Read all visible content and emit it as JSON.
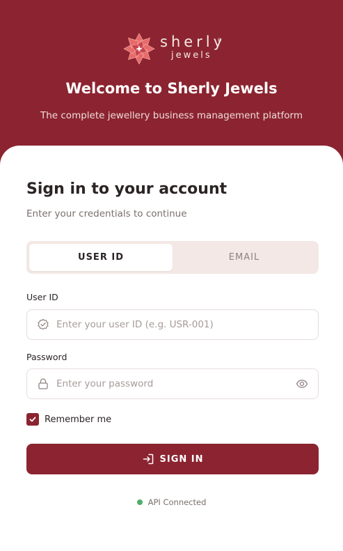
{
  "brand": {
    "line1": "sherly",
    "line2": "jewels",
    "reg_mark": "®",
    "logo_icon": "flower-gem-icon"
  },
  "hero": {
    "title": "Welcome to Sherly Jewels",
    "subtitle": "The complete jewellery business management platform"
  },
  "form": {
    "title": "Sign in to your account",
    "subtitle": "Enter your credentials to continue",
    "tabs": [
      {
        "label": "USER ID",
        "active": true
      },
      {
        "label": "EMAIL",
        "active": false
      }
    ],
    "user_id": {
      "label": "User ID",
      "placeholder": "Enter your user ID (e.g. USR-001)",
      "value": "",
      "icon": "badge-check-icon"
    },
    "password": {
      "label": "Password",
      "placeholder": "Enter your password",
      "value": "",
      "icon": "lock-icon",
      "toggle_icon": "eye-icon"
    },
    "remember": {
      "label": "Remember me",
      "checked": true
    },
    "submit_label": "SIGN IN",
    "submit_icon": "sign-in-icon"
  },
  "status": {
    "text": "API Connected",
    "color": "#4caf6a"
  },
  "colors": {
    "brand": "#8b2430",
    "tab_bg": "#f3e8e5"
  }
}
